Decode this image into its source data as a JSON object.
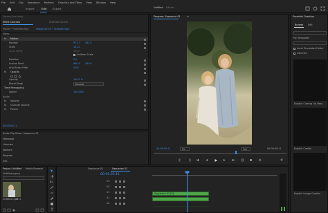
{
  "menu": [
    "File",
    "Edit",
    "Clip",
    "Sequence",
    "Markers",
    "Graphics and Titles",
    "View",
    "Window",
    "Help"
  ],
  "workspace_tabs": {
    "import": "Import",
    "edit": "Edit",
    "export": "Export"
  },
  "project_title": "Untitled",
  "project_subtitle": "Edited",
  "source_panel": {
    "tab": "Source: (no clips)",
    "effect_controls": "Effect Controls",
    "essential_sound": "Essential Sound",
    "master_label": "Master * Untitled.mp4",
    "seq_label": "Sequence 01 * Untitled.mp4"
  },
  "effect_controls": {
    "video_label": "Video",
    "motion": "Motion",
    "position": {
      "label": "Position",
      "x": "972.7",
      "y": "442.5"
    },
    "scale": {
      "label": "Scale",
      "value": "101.0"
    },
    "scale_width": {
      "label": "Scale Width",
      "value": "100.0"
    },
    "uniform_scale": "Uniform Scale",
    "rotation": {
      "label": "Rotation",
      "value": "0.0"
    },
    "anchor_point": {
      "label": "Anchor Point",
      "x": "960.0",
      "y": "540.0"
    },
    "anti_flicker": {
      "label": "Anti-flicker Filter",
      "value": "0.00"
    },
    "opacity": "Opacity",
    "opacity_value": {
      "label": "Opacity",
      "value": "100.0 %"
    },
    "blend_mode": {
      "label": "Blend Mode",
      "value": "Normal"
    },
    "time_remapping": "Time Remapping",
    "speed": {
      "label": "Speed",
      "value": "100.00%"
    },
    "audio_label": "Audio",
    "volume": "Volume",
    "channel_volume": "Channel Volume",
    "panner": "Panner",
    "timecode": "00:00:05:11"
  },
  "left_lower_tabs": [
    "Audio Clip Mixer: Sequence 01",
    "Metadata",
    "Libraries",
    "Markers",
    "Program",
    "Info"
  ],
  "program_monitor": {
    "tab": "Program: Sequence 01",
    "menu_icon": "≡",
    "timecode_left": "00:00:05:11",
    "fit": "Fit",
    "quality": "Full",
    "timecode_right": "00:00:09:11"
  },
  "project_panel": {
    "tab": "Project: Untitled",
    "media_browser": "Media Browser",
    "file_name": "Untitled.prproj",
    "clip_label": "Untitled.mp4",
    "clip_duration": "5:11"
  },
  "timeline": {
    "tabs": [
      "Sequence 01",
      "Sequence 01"
    ],
    "timecode": "00:00:05:11",
    "clip_name": "Sequence 01 [V]",
    "tracks": [
      "V3",
      "V2",
      "V1",
      "A1",
      "A2"
    ]
  },
  "essential_graphics": {
    "tab": "Essential Graphics",
    "browse": "Browse",
    "edit": "Edit",
    "my_templates": "My Templates",
    "local_templates": "Local Templates Folder",
    "libraries": "Libraries",
    "items": [
      "English Coming Up Next",
      "English Credits",
      "English Image Caption"
    ]
  },
  "colors": {
    "accent": "#3c8fe8",
    "panel_bg": "#232323",
    "clip_green": "#4fa54a",
    "playhead": "#3c8fe8"
  }
}
